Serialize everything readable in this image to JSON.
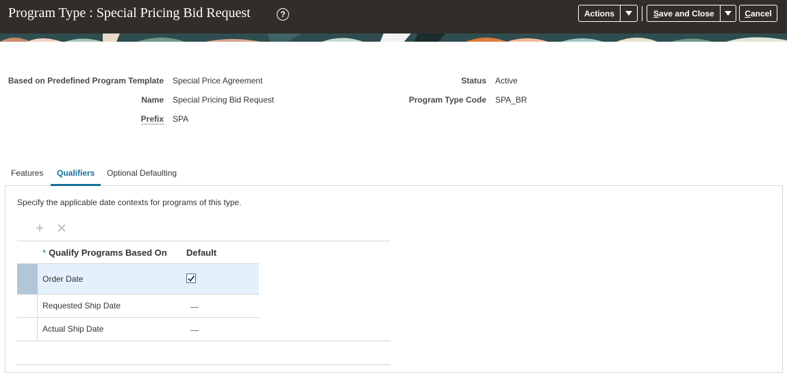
{
  "header": {
    "title": "Program Type : Special Pricing Bid Request",
    "help_icon": "?",
    "actions_label": "Actions",
    "save_close_label": "Save and Close",
    "cancel_label": "Cancel",
    "background_color": "#312d2a"
  },
  "form": {
    "template_label": "Based on Predefined Program Template",
    "template_value": "Special Price Agreement",
    "name_label": "Name",
    "name_value": "Special Pricing Bid Request",
    "prefix_label": "Prefix",
    "prefix_value": "SPA",
    "status_label": "Status",
    "status_value": "Active",
    "code_label": "Program Type Code",
    "code_value": "SPA_BR"
  },
  "tabs": [
    {
      "label": "Features",
      "active": false
    },
    {
      "label": "Qualifiers",
      "active": true
    },
    {
      "label": "Optional Defaulting",
      "active": false
    }
  ],
  "qualifiers": {
    "instruction": "Specify the applicable date contexts for programs of this type.",
    "toolbar": {
      "add_icon": "add-icon",
      "delete_icon": "delete-icon"
    },
    "columns": {
      "required_marker": "*",
      "qualify": "Qualify Programs Based On",
      "default": "Default"
    },
    "rows": [
      {
        "name": "Order Date",
        "default": true,
        "selected": true
      },
      {
        "name": "Requested Ship Date",
        "default": false,
        "selected": false
      },
      {
        "name": "Actual Ship Date",
        "default": false,
        "selected": false
      }
    ]
  },
  "colors": {
    "accent": "#1a6f99",
    "selected_row": "#e4f0fb",
    "selected_handle": "#b3c6d8"
  }
}
